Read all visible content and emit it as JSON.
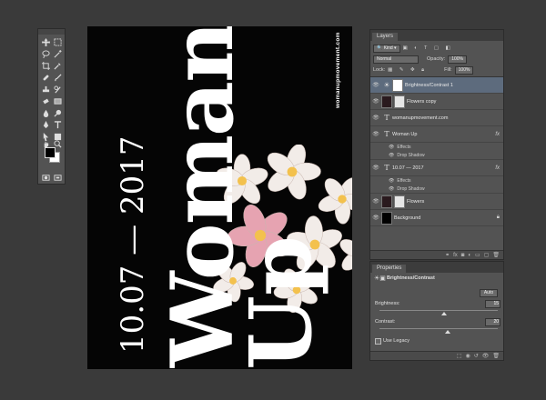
{
  "poster": {
    "line1": "Woman",
    "line2": "Up",
    "date": "10.07 — 2017",
    "website": "womanupmovement.com"
  },
  "layers_panel": {
    "tab": "Layers",
    "kind_label": "Kind",
    "blend_mode": "Normal",
    "opacity_label": "Opacity:",
    "opacity_value": "100%",
    "lock_label": "Lock:",
    "fill_label": "Fill:",
    "fill_value": "100%",
    "layers": [
      {
        "name": "Brightness/Contrast 1",
        "type": "adjustment",
        "selected": true
      },
      {
        "name": "Flowers copy",
        "type": "pixel"
      },
      {
        "name": "womanupmovement.com",
        "type": "text"
      },
      {
        "name": "Woman Up",
        "type": "text",
        "fx": "fx",
        "effects_label": "Effects",
        "effect": "Drop Shadow"
      },
      {
        "name": "10.07 — 2017",
        "type": "text",
        "fx": "fx",
        "effects_label": "Effects",
        "effect": "Drop Shadow"
      },
      {
        "name": "Flowers",
        "type": "pixel"
      },
      {
        "name": "Background",
        "type": "background"
      }
    ]
  },
  "properties_panel": {
    "tab": "Properties",
    "title": "Brightness/Contrast",
    "auto_button": "Auto",
    "brightness_label": "Brightness:",
    "brightness_value": "15",
    "contrast_label": "Contrast:",
    "contrast_value": "20",
    "legacy_label": "Use Legacy"
  },
  "colors": {
    "workspace": "#3a3a3a",
    "panel": "#535353",
    "selected_layer": "#5d6b7d",
    "canvas": "#050505"
  }
}
